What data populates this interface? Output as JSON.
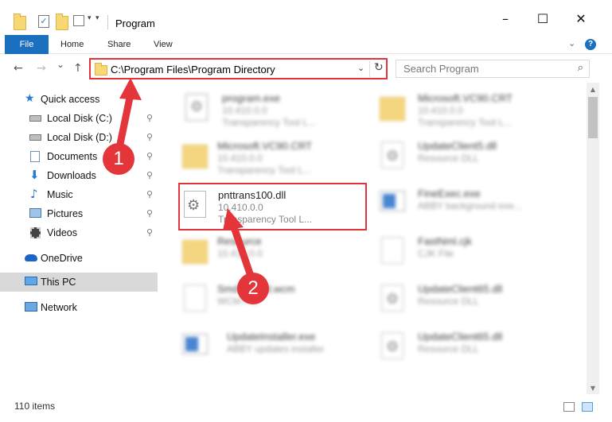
{
  "window": {
    "title": "Program",
    "minimize": "–",
    "maximize": "☐",
    "close": "✕"
  },
  "ribbon": {
    "tabs": [
      "File",
      "Home",
      "Share",
      "View"
    ],
    "expand_icon": "chevron-down-icon",
    "help": "?"
  },
  "nav": {
    "back": "←",
    "forward": "→",
    "recent": "⌄",
    "up": "↑",
    "address": "C:\\Program Files\\Program Directory",
    "refresh": "↻",
    "search_placeholder": "Search Program"
  },
  "sidebar": {
    "items": [
      {
        "label": "Quick access",
        "icon": "star-icon",
        "pinned": false
      },
      {
        "label": "Local Disk (C:)",
        "icon": "drive-icon",
        "pinned": true
      },
      {
        "label": "Local Disk (D:)",
        "icon": "drive-icon",
        "pinned": true
      },
      {
        "label": "Documents",
        "icon": "documents-icon",
        "pinned": true
      },
      {
        "label": "Downloads",
        "icon": "download-icon",
        "pinned": true
      },
      {
        "label": "Music",
        "icon": "music-icon",
        "pinned": true
      },
      {
        "label": "Pictures",
        "icon": "pictures-icon",
        "pinned": true
      },
      {
        "label": "Videos",
        "icon": "videos-icon",
        "pinned": true
      },
      {
        "label": "OneDrive",
        "icon": "cloud-icon",
        "pinned": false
      },
      {
        "label": "This PC",
        "icon": "computer-icon",
        "pinned": false,
        "selected": true
      },
      {
        "label": "Network",
        "icon": "network-icon",
        "pinned": false
      }
    ],
    "pin_glyph": "📌"
  },
  "files": [
    {
      "name": "program.exe",
      "line1": "10.410.0.0",
      "line2": "Transparency Tool L...",
      "icon": "exe-icon"
    },
    {
      "name": "Microsoft.VC90.CRT",
      "line1": "10.410.0.0",
      "line2": "Transparency Tool L...",
      "icon": "folder-icon"
    },
    {
      "name": "Microsoft.VC90.CRT",
      "line1": "10.410.0.0",
      "line2": "Transparency Tool L...",
      "icon": "folder-icon"
    },
    {
      "name": "UpdateClient5.dll",
      "line1": "Resource DLL",
      "line2": "",
      "icon": "dll-icon"
    },
    {
      "name": "pnttrans100.dll",
      "line1": "10.410.0.0",
      "line2": "Transparency Tool L...",
      "icon": "dll-icon"
    },
    {
      "name": "FineExec.exe",
      "line1": "ABBY background exe...",
      "line2": "",
      "icon": "exe-icon"
    },
    {
      "name": "Resource",
      "line1": "10.410.0.0",
      "line2": "",
      "icon": "folder-icon"
    },
    {
      "name": "FastNml.cjk",
      "line1": "CJK File",
      "line2": "",
      "icon": "file-icon"
    },
    {
      "name": "SmdPinned.wcm",
      "line1": "WCM File",
      "line2": "",
      "icon": "file-icon"
    },
    {
      "name": "UpdateClient65.dll",
      "line1": "Resource DLL",
      "line2": "",
      "icon": "dll-icon"
    },
    {
      "name": "UpdateInstaller.exe",
      "line1": "ABBY updates installer",
      "line2": "",
      "icon": "exe-icon"
    },
    {
      "name": "UpdateClient65.dll",
      "line1": "Resource DLL",
      "line2": "",
      "icon": "dll-icon"
    }
  ],
  "status": {
    "item_count": "110 items"
  },
  "annotations": {
    "step1": "1",
    "step2": "2"
  }
}
